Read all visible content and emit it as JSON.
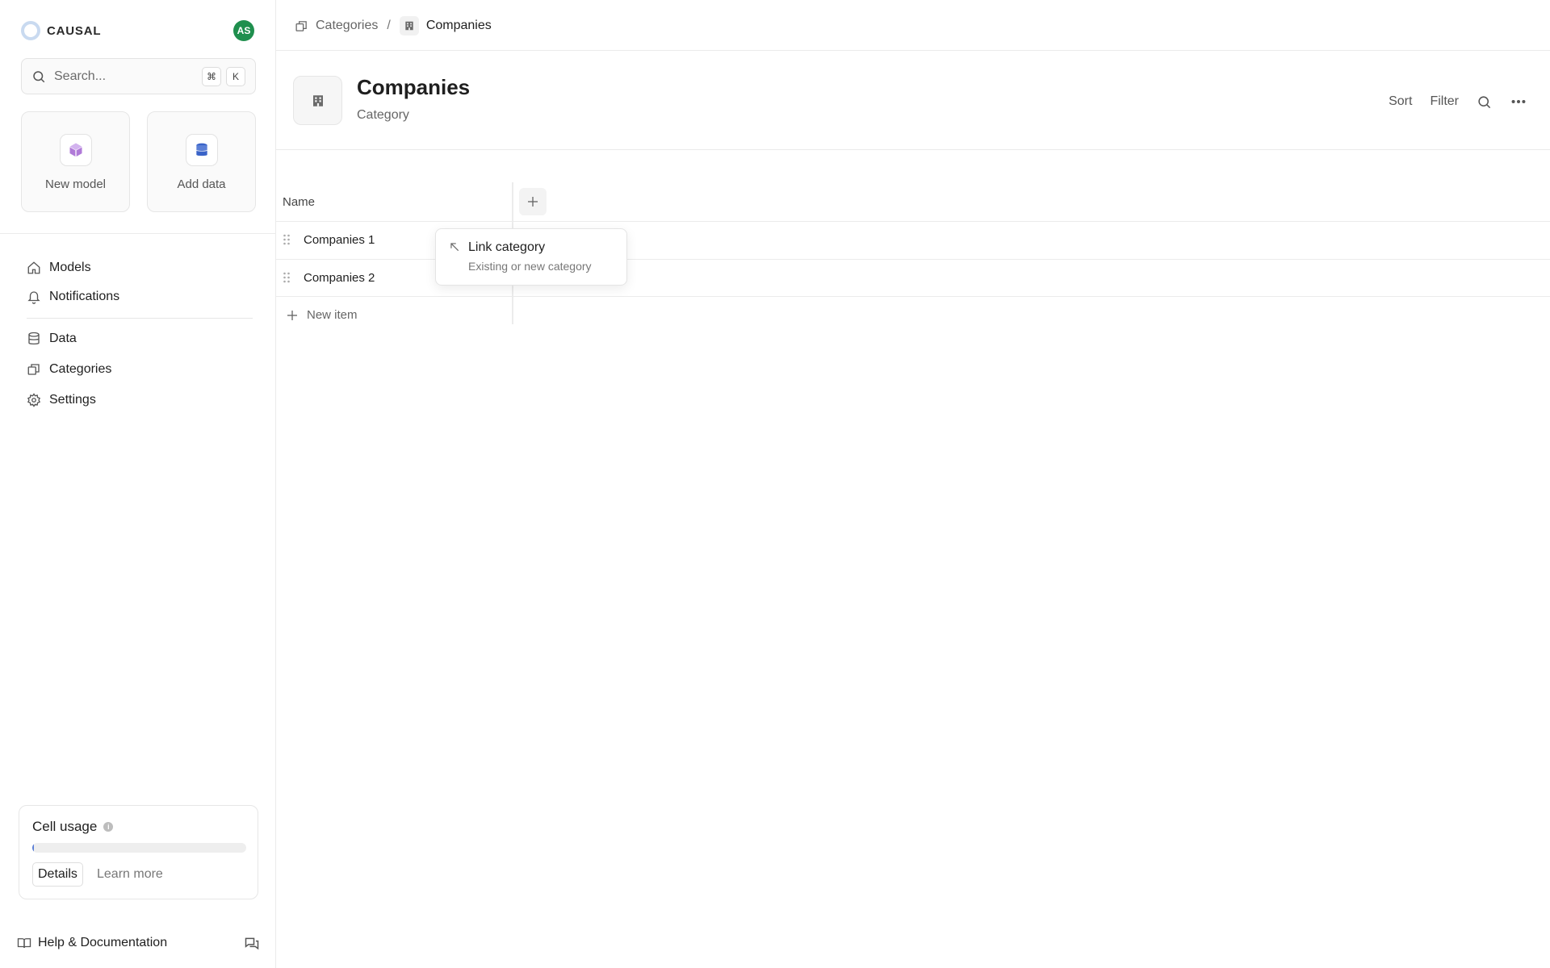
{
  "brand": {
    "name": "CAUSAL",
    "avatar_initials": "AS",
    "colors": {
      "avatar": "#1f8f4e",
      "ring": "#c9daf0"
    }
  },
  "search": {
    "placeholder": "Search...",
    "shortcut_mod": "⌘",
    "shortcut_key": "K"
  },
  "quick_actions": [
    {
      "label": "New model",
      "icon": "cube-icon"
    },
    {
      "label": "Add data",
      "icon": "database-icon"
    }
  ],
  "nav": {
    "primary": [
      {
        "label": "Models",
        "icon": "home-icon"
      },
      {
        "label": "Notifications",
        "icon": "bell-icon"
      }
    ],
    "secondary": [
      {
        "label": "Data",
        "icon": "database-icon"
      },
      {
        "label": "Categories",
        "icon": "categories-icon"
      },
      {
        "label": "Settings",
        "icon": "gear-icon"
      }
    ]
  },
  "cell_usage": {
    "title": "Cell usage",
    "info": "i",
    "fraction": 0.004,
    "details_label": "Details",
    "learn_more_label": "Learn more"
  },
  "footer": {
    "help_label": "Help & Documentation"
  },
  "breadcrumb": {
    "parent": "Categories",
    "separator": "/",
    "current": "Companies"
  },
  "page": {
    "title": "Companies",
    "subtitle": "Category"
  },
  "toolbar": {
    "sort_label": "Sort",
    "filter_label": "Filter"
  },
  "table": {
    "name_header": "Name",
    "rows": [
      {
        "label": "Companies 1"
      },
      {
        "label": "Companies 2"
      }
    ],
    "new_item_label": "New item"
  },
  "popover": {
    "title": "Link category",
    "subtitle": "Existing or new category"
  }
}
